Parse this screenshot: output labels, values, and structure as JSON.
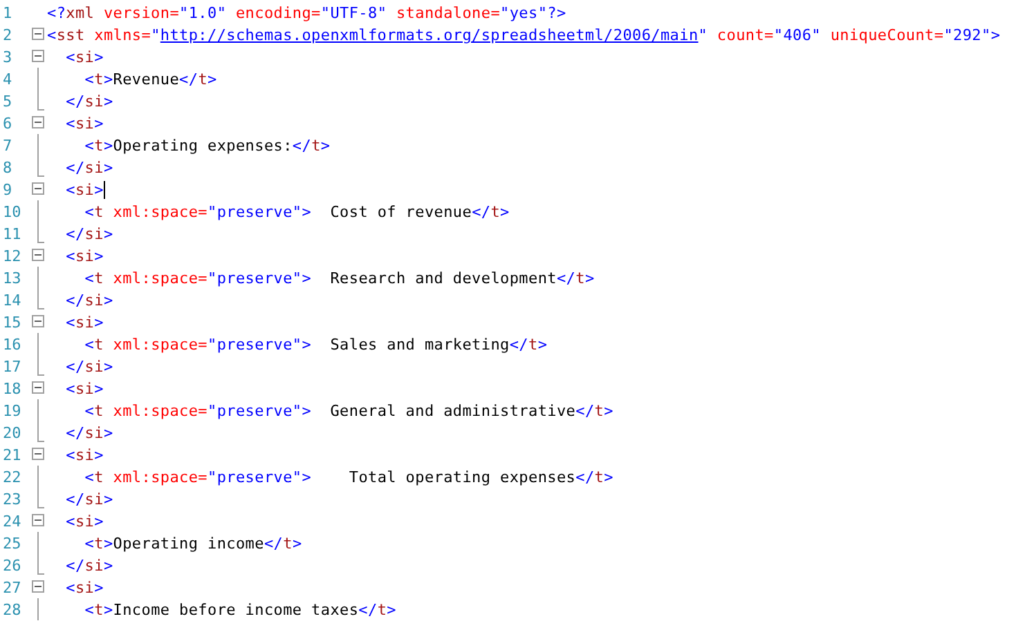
{
  "editor": {
    "lines": [
      {
        "number": "1",
        "kind": "plain",
        "cursor": false,
        "tokens": [
          {
            "kind": "punct",
            "text": "<?"
          },
          {
            "kind": "name",
            "text": "xml"
          },
          {
            "kind": "attr",
            "text": " version="
          },
          {
            "kind": "value",
            "text": "\"1.0\""
          },
          {
            "kind": "attr",
            "text": " encoding="
          },
          {
            "kind": "value",
            "text": "\"UTF-8\""
          },
          {
            "kind": "attr",
            "text": " standalone="
          },
          {
            "kind": "value",
            "text": "\"yes\""
          },
          {
            "kind": "punct",
            "text": "?>"
          }
        ]
      },
      {
        "number": "2",
        "kind": "open",
        "cursor": false,
        "expanded": true,
        "tokens": [
          {
            "kind": "punct",
            "text": "<"
          },
          {
            "kind": "name",
            "text": "sst"
          },
          {
            "kind": "attr",
            "text": " xmlns="
          },
          {
            "kind": "value",
            "text": "\""
          },
          {
            "kind": "link",
            "text": "http://schemas.openxmlformats.org/spreadsheetml/2006/main"
          },
          {
            "kind": "value",
            "text": "\""
          },
          {
            "kind": "attr",
            "text": " count="
          },
          {
            "kind": "value",
            "text": "\"406\""
          },
          {
            "kind": "attr",
            "text": " uniqueCount="
          },
          {
            "kind": "value",
            "text": "\"292\""
          },
          {
            "kind": "punct",
            "text": ">"
          }
        ]
      },
      {
        "number": "3",
        "kind": "open",
        "cursor": false,
        "expanded": true,
        "tokens": [
          {
            "kind": "punct",
            "text": "  <"
          },
          {
            "kind": "name",
            "text": "si"
          },
          {
            "kind": "punct",
            "text": ">"
          }
        ]
      },
      {
        "number": "4",
        "kind": "inside",
        "cursor": false,
        "tokens": [
          {
            "kind": "punct",
            "text": "    <"
          },
          {
            "kind": "name",
            "text": "t"
          },
          {
            "kind": "punct",
            "text": ">"
          },
          {
            "kind": "text",
            "text": "Revenue"
          },
          {
            "kind": "punct",
            "text": "</"
          },
          {
            "kind": "name",
            "text": "t"
          },
          {
            "kind": "punct",
            "text": ">"
          }
        ]
      },
      {
        "number": "5",
        "kind": "end",
        "cursor": false,
        "tokens": [
          {
            "kind": "punct",
            "text": "  </"
          },
          {
            "kind": "name",
            "text": "si"
          },
          {
            "kind": "punct",
            "text": ">"
          }
        ]
      },
      {
        "number": "6",
        "kind": "open",
        "cursor": false,
        "expanded": true,
        "tokens": [
          {
            "kind": "punct",
            "text": "  <"
          },
          {
            "kind": "name",
            "text": "si"
          },
          {
            "kind": "punct",
            "text": ">"
          }
        ]
      },
      {
        "number": "7",
        "kind": "inside",
        "cursor": false,
        "tokens": [
          {
            "kind": "punct",
            "text": "    <"
          },
          {
            "kind": "name",
            "text": "t"
          },
          {
            "kind": "punct",
            "text": ">"
          },
          {
            "kind": "text",
            "text": "Operating expenses:"
          },
          {
            "kind": "punct",
            "text": "</"
          },
          {
            "kind": "name",
            "text": "t"
          },
          {
            "kind": "punct",
            "text": ">"
          }
        ]
      },
      {
        "number": "8",
        "kind": "end",
        "cursor": false,
        "tokens": [
          {
            "kind": "punct",
            "text": "  </"
          },
          {
            "kind": "name",
            "text": "si"
          },
          {
            "kind": "punct",
            "text": ">"
          }
        ]
      },
      {
        "number": "9",
        "kind": "open",
        "cursor": true,
        "expanded": true,
        "tokens": [
          {
            "kind": "punct",
            "text": "  <"
          },
          {
            "kind": "name",
            "text": "si"
          },
          {
            "kind": "punct",
            "text": ">"
          }
        ]
      },
      {
        "number": "10",
        "kind": "inside",
        "cursor": false,
        "tokens": [
          {
            "kind": "punct",
            "text": "    <"
          },
          {
            "kind": "name",
            "text": "t"
          },
          {
            "kind": "attr",
            "text": " xml:space="
          },
          {
            "kind": "value",
            "text": "\"preserve\""
          },
          {
            "kind": "punct",
            "text": ">"
          },
          {
            "kind": "text",
            "text": "  Cost of revenue"
          },
          {
            "kind": "punct",
            "text": "</"
          },
          {
            "kind": "name",
            "text": "t"
          },
          {
            "kind": "punct",
            "text": ">"
          }
        ]
      },
      {
        "number": "11",
        "kind": "end",
        "cursor": false,
        "tokens": [
          {
            "kind": "punct",
            "text": "  </"
          },
          {
            "kind": "name",
            "text": "si"
          },
          {
            "kind": "punct",
            "text": ">"
          }
        ]
      },
      {
        "number": "12",
        "kind": "open",
        "cursor": false,
        "expanded": true,
        "tokens": [
          {
            "kind": "punct",
            "text": "  <"
          },
          {
            "kind": "name",
            "text": "si"
          },
          {
            "kind": "punct",
            "text": ">"
          }
        ]
      },
      {
        "number": "13",
        "kind": "inside",
        "cursor": false,
        "tokens": [
          {
            "kind": "punct",
            "text": "    <"
          },
          {
            "kind": "name",
            "text": "t"
          },
          {
            "kind": "attr",
            "text": " xml:space="
          },
          {
            "kind": "value",
            "text": "\"preserve\""
          },
          {
            "kind": "punct",
            "text": ">"
          },
          {
            "kind": "text",
            "text": "  Research and development"
          },
          {
            "kind": "punct",
            "text": "</"
          },
          {
            "kind": "name",
            "text": "t"
          },
          {
            "kind": "punct",
            "text": ">"
          }
        ]
      },
      {
        "number": "14",
        "kind": "end",
        "cursor": false,
        "tokens": [
          {
            "kind": "punct",
            "text": "  </"
          },
          {
            "kind": "name",
            "text": "si"
          },
          {
            "kind": "punct",
            "text": ">"
          }
        ]
      },
      {
        "number": "15",
        "kind": "open",
        "cursor": false,
        "expanded": true,
        "tokens": [
          {
            "kind": "punct",
            "text": "  <"
          },
          {
            "kind": "name",
            "text": "si"
          },
          {
            "kind": "punct",
            "text": ">"
          }
        ]
      },
      {
        "number": "16",
        "kind": "inside",
        "cursor": false,
        "tokens": [
          {
            "kind": "punct",
            "text": "    <"
          },
          {
            "kind": "name",
            "text": "t"
          },
          {
            "kind": "attr",
            "text": " xml:space="
          },
          {
            "kind": "value",
            "text": "\"preserve\""
          },
          {
            "kind": "punct",
            "text": ">"
          },
          {
            "kind": "text",
            "text": "  Sales and marketing"
          },
          {
            "kind": "punct",
            "text": "</"
          },
          {
            "kind": "name",
            "text": "t"
          },
          {
            "kind": "punct",
            "text": ">"
          }
        ]
      },
      {
        "number": "17",
        "kind": "end",
        "cursor": false,
        "tokens": [
          {
            "kind": "punct",
            "text": "  </"
          },
          {
            "kind": "name",
            "text": "si"
          },
          {
            "kind": "punct",
            "text": ">"
          }
        ]
      },
      {
        "number": "18",
        "kind": "open",
        "cursor": false,
        "expanded": true,
        "tokens": [
          {
            "kind": "punct",
            "text": "  <"
          },
          {
            "kind": "name",
            "text": "si"
          },
          {
            "kind": "punct",
            "text": ">"
          }
        ]
      },
      {
        "number": "19",
        "kind": "inside",
        "cursor": false,
        "tokens": [
          {
            "kind": "punct",
            "text": "    <"
          },
          {
            "kind": "name",
            "text": "t"
          },
          {
            "kind": "attr",
            "text": " xml:space="
          },
          {
            "kind": "value",
            "text": "\"preserve\""
          },
          {
            "kind": "punct",
            "text": ">"
          },
          {
            "kind": "text",
            "text": "  General and administrative"
          },
          {
            "kind": "punct",
            "text": "</"
          },
          {
            "kind": "name",
            "text": "t"
          },
          {
            "kind": "punct",
            "text": ">"
          }
        ]
      },
      {
        "number": "20",
        "kind": "end",
        "cursor": false,
        "tokens": [
          {
            "kind": "punct",
            "text": "  </"
          },
          {
            "kind": "name",
            "text": "si"
          },
          {
            "kind": "punct",
            "text": ">"
          }
        ]
      },
      {
        "number": "21",
        "kind": "open",
        "cursor": false,
        "expanded": true,
        "tokens": [
          {
            "kind": "punct",
            "text": "  <"
          },
          {
            "kind": "name",
            "text": "si"
          },
          {
            "kind": "punct",
            "text": ">"
          }
        ]
      },
      {
        "number": "22",
        "kind": "inside",
        "cursor": false,
        "tokens": [
          {
            "kind": "punct",
            "text": "    <"
          },
          {
            "kind": "name",
            "text": "t"
          },
          {
            "kind": "attr",
            "text": " xml:space="
          },
          {
            "kind": "value",
            "text": "\"preserve\""
          },
          {
            "kind": "punct",
            "text": ">"
          },
          {
            "kind": "text",
            "text": "    Total operating expenses"
          },
          {
            "kind": "punct",
            "text": "</"
          },
          {
            "kind": "name",
            "text": "t"
          },
          {
            "kind": "punct",
            "text": ">"
          }
        ]
      },
      {
        "number": "23",
        "kind": "end",
        "cursor": false,
        "tokens": [
          {
            "kind": "punct",
            "text": "  </"
          },
          {
            "kind": "name",
            "text": "si"
          },
          {
            "kind": "punct",
            "text": ">"
          }
        ]
      },
      {
        "number": "24",
        "kind": "open",
        "cursor": false,
        "expanded": true,
        "tokens": [
          {
            "kind": "punct",
            "text": "  <"
          },
          {
            "kind": "name",
            "text": "si"
          },
          {
            "kind": "punct",
            "text": ">"
          }
        ]
      },
      {
        "number": "25",
        "kind": "inside",
        "cursor": false,
        "tokens": [
          {
            "kind": "punct",
            "text": "    <"
          },
          {
            "kind": "name",
            "text": "t"
          },
          {
            "kind": "punct",
            "text": ">"
          },
          {
            "kind": "text",
            "text": "Operating income"
          },
          {
            "kind": "punct",
            "text": "</"
          },
          {
            "kind": "name",
            "text": "t"
          },
          {
            "kind": "punct",
            "text": ">"
          }
        ]
      },
      {
        "number": "26",
        "kind": "end",
        "cursor": false,
        "tokens": [
          {
            "kind": "punct",
            "text": "  </"
          },
          {
            "kind": "name",
            "text": "si"
          },
          {
            "kind": "punct",
            "text": ">"
          }
        ]
      },
      {
        "number": "27",
        "kind": "open",
        "cursor": false,
        "expanded": true,
        "tokens": [
          {
            "kind": "punct",
            "text": "  <"
          },
          {
            "kind": "name",
            "text": "si"
          },
          {
            "kind": "punct",
            "text": ">"
          }
        ]
      },
      {
        "number": "28",
        "kind": "inside",
        "cursor": false,
        "tokens": [
          {
            "kind": "punct",
            "text": "    <"
          },
          {
            "kind": "name",
            "text": "t"
          },
          {
            "kind": "punct",
            "text": ">"
          },
          {
            "kind": "text",
            "text": "Income before income taxes"
          },
          {
            "kind": "punct",
            "text": "</"
          },
          {
            "kind": "name",
            "text": "t"
          },
          {
            "kind": "punct",
            "text": ">"
          }
        ]
      }
    ]
  }
}
